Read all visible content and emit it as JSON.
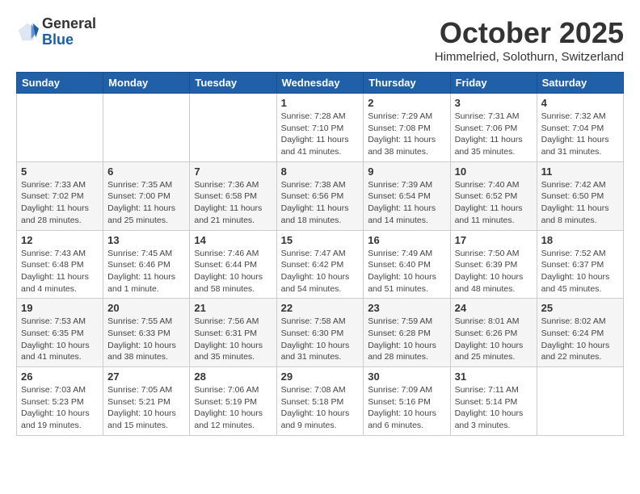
{
  "logo": {
    "general": "General",
    "blue": "Blue"
  },
  "header": {
    "month": "October 2025",
    "location": "Himmelried, Solothurn, Switzerland"
  },
  "weekdays": [
    "Sunday",
    "Monday",
    "Tuesday",
    "Wednesday",
    "Thursday",
    "Friday",
    "Saturday"
  ],
  "weeks": [
    [
      {
        "day": "",
        "sunrise": "",
        "sunset": "",
        "daylight": ""
      },
      {
        "day": "",
        "sunrise": "",
        "sunset": "",
        "daylight": ""
      },
      {
        "day": "",
        "sunrise": "",
        "sunset": "",
        "daylight": ""
      },
      {
        "day": "1",
        "sunrise": "Sunrise: 7:28 AM",
        "sunset": "Sunset: 7:10 PM",
        "daylight": "Daylight: 11 hours and 41 minutes."
      },
      {
        "day": "2",
        "sunrise": "Sunrise: 7:29 AM",
        "sunset": "Sunset: 7:08 PM",
        "daylight": "Daylight: 11 hours and 38 minutes."
      },
      {
        "day": "3",
        "sunrise": "Sunrise: 7:31 AM",
        "sunset": "Sunset: 7:06 PM",
        "daylight": "Daylight: 11 hours and 35 minutes."
      },
      {
        "day": "4",
        "sunrise": "Sunrise: 7:32 AM",
        "sunset": "Sunset: 7:04 PM",
        "daylight": "Daylight: 11 hours and 31 minutes."
      }
    ],
    [
      {
        "day": "5",
        "sunrise": "Sunrise: 7:33 AM",
        "sunset": "Sunset: 7:02 PM",
        "daylight": "Daylight: 11 hours and 28 minutes."
      },
      {
        "day": "6",
        "sunrise": "Sunrise: 7:35 AM",
        "sunset": "Sunset: 7:00 PM",
        "daylight": "Daylight: 11 hours and 25 minutes."
      },
      {
        "day": "7",
        "sunrise": "Sunrise: 7:36 AM",
        "sunset": "Sunset: 6:58 PM",
        "daylight": "Daylight: 11 hours and 21 minutes."
      },
      {
        "day": "8",
        "sunrise": "Sunrise: 7:38 AM",
        "sunset": "Sunset: 6:56 PM",
        "daylight": "Daylight: 11 hours and 18 minutes."
      },
      {
        "day": "9",
        "sunrise": "Sunrise: 7:39 AM",
        "sunset": "Sunset: 6:54 PM",
        "daylight": "Daylight: 11 hours and 14 minutes."
      },
      {
        "day": "10",
        "sunrise": "Sunrise: 7:40 AM",
        "sunset": "Sunset: 6:52 PM",
        "daylight": "Daylight: 11 hours and 11 minutes."
      },
      {
        "day": "11",
        "sunrise": "Sunrise: 7:42 AM",
        "sunset": "Sunset: 6:50 PM",
        "daylight": "Daylight: 11 hours and 8 minutes."
      }
    ],
    [
      {
        "day": "12",
        "sunrise": "Sunrise: 7:43 AM",
        "sunset": "Sunset: 6:48 PM",
        "daylight": "Daylight: 11 hours and 4 minutes."
      },
      {
        "day": "13",
        "sunrise": "Sunrise: 7:45 AM",
        "sunset": "Sunset: 6:46 PM",
        "daylight": "Daylight: 11 hours and 1 minute."
      },
      {
        "day": "14",
        "sunrise": "Sunrise: 7:46 AM",
        "sunset": "Sunset: 6:44 PM",
        "daylight": "Daylight: 10 hours and 58 minutes."
      },
      {
        "day": "15",
        "sunrise": "Sunrise: 7:47 AM",
        "sunset": "Sunset: 6:42 PM",
        "daylight": "Daylight: 10 hours and 54 minutes."
      },
      {
        "day": "16",
        "sunrise": "Sunrise: 7:49 AM",
        "sunset": "Sunset: 6:40 PM",
        "daylight": "Daylight: 10 hours and 51 minutes."
      },
      {
        "day": "17",
        "sunrise": "Sunrise: 7:50 AM",
        "sunset": "Sunset: 6:39 PM",
        "daylight": "Daylight: 10 hours and 48 minutes."
      },
      {
        "day": "18",
        "sunrise": "Sunrise: 7:52 AM",
        "sunset": "Sunset: 6:37 PM",
        "daylight": "Daylight: 10 hours and 45 minutes."
      }
    ],
    [
      {
        "day": "19",
        "sunrise": "Sunrise: 7:53 AM",
        "sunset": "Sunset: 6:35 PM",
        "daylight": "Daylight: 10 hours and 41 minutes."
      },
      {
        "day": "20",
        "sunrise": "Sunrise: 7:55 AM",
        "sunset": "Sunset: 6:33 PM",
        "daylight": "Daylight: 10 hours and 38 minutes."
      },
      {
        "day": "21",
        "sunrise": "Sunrise: 7:56 AM",
        "sunset": "Sunset: 6:31 PM",
        "daylight": "Daylight: 10 hours and 35 minutes."
      },
      {
        "day": "22",
        "sunrise": "Sunrise: 7:58 AM",
        "sunset": "Sunset: 6:30 PM",
        "daylight": "Daylight: 10 hours and 31 minutes."
      },
      {
        "day": "23",
        "sunrise": "Sunrise: 7:59 AM",
        "sunset": "Sunset: 6:28 PM",
        "daylight": "Daylight: 10 hours and 28 minutes."
      },
      {
        "day": "24",
        "sunrise": "Sunrise: 8:01 AM",
        "sunset": "Sunset: 6:26 PM",
        "daylight": "Daylight: 10 hours and 25 minutes."
      },
      {
        "day": "25",
        "sunrise": "Sunrise: 8:02 AM",
        "sunset": "Sunset: 6:24 PM",
        "daylight": "Daylight: 10 hours and 22 minutes."
      }
    ],
    [
      {
        "day": "26",
        "sunrise": "Sunrise: 7:03 AM",
        "sunset": "Sunset: 5:23 PM",
        "daylight": "Daylight: 10 hours and 19 minutes."
      },
      {
        "day": "27",
        "sunrise": "Sunrise: 7:05 AM",
        "sunset": "Sunset: 5:21 PM",
        "daylight": "Daylight: 10 hours and 15 minutes."
      },
      {
        "day": "28",
        "sunrise": "Sunrise: 7:06 AM",
        "sunset": "Sunset: 5:19 PM",
        "daylight": "Daylight: 10 hours and 12 minutes."
      },
      {
        "day": "29",
        "sunrise": "Sunrise: 7:08 AM",
        "sunset": "Sunset: 5:18 PM",
        "daylight": "Daylight: 10 hours and 9 minutes."
      },
      {
        "day": "30",
        "sunrise": "Sunrise: 7:09 AM",
        "sunset": "Sunset: 5:16 PM",
        "daylight": "Daylight: 10 hours and 6 minutes."
      },
      {
        "day": "31",
        "sunrise": "Sunrise: 7:11 AM",
        "sunset": "Sunset: 5:14 PM",
        "daylight": "Daylight: 10 hours and 3 minutes."
      },
      {
        "day": "",
        "sunrise": "",
        "sunset": "",
        "daylight": ""
      }
    ]
  ]
}
